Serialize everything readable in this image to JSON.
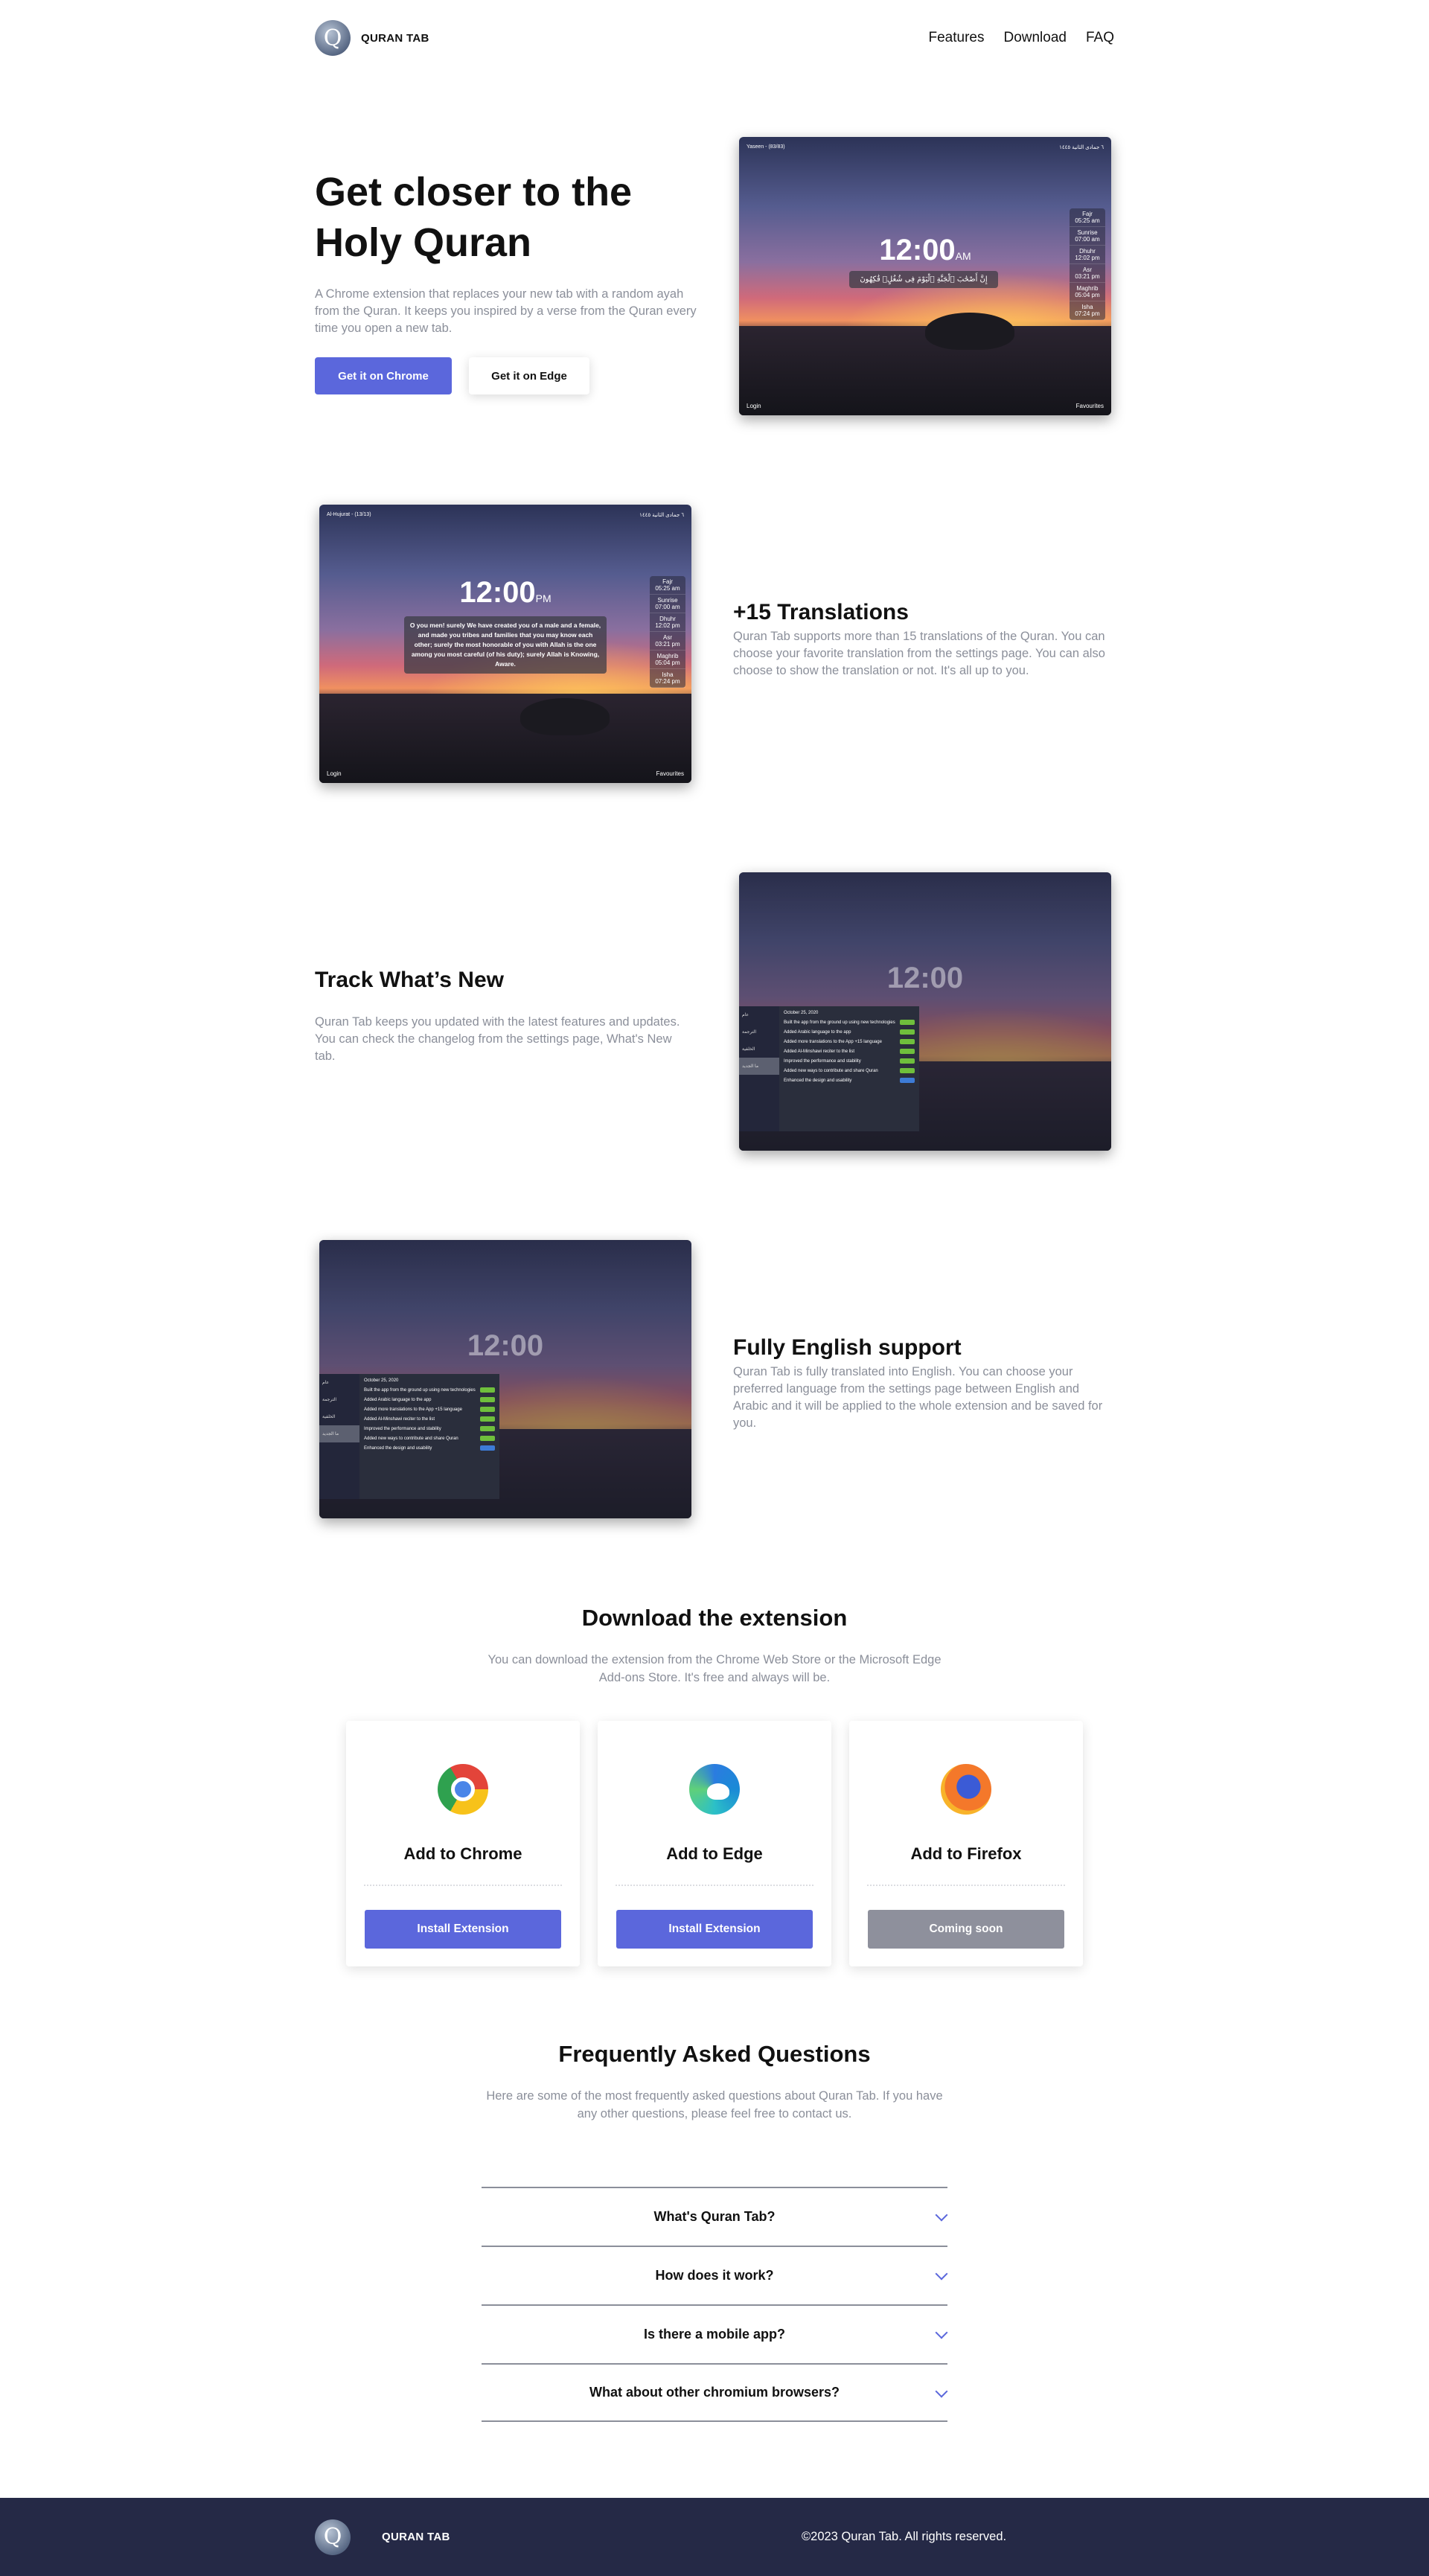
{
  "header": {
    "brand": "QURAN TAB",
    "logo_letter": "Q",
    "nav": [
      "Features",
      "Download",
      "FAQ"
    ]
  },
  "hero": {
    "title_line1": "Get closer to the",
    "title_line2": "Holy Quran",
    "description": "A Chrome extension that replaces your new tab with a random ayah from the Quran. It keeps you inspired by a verse from the Quran every time you open a new tab.",
    "btn_chrome": "Get it on Chrome",
    "btn_edge": "Get it on Edge"
  },
  "mock": {
    "time": "12:00",
    "ampm": "AM",
    "pm": "PM",
    "surah1": "Yaseen - (83/83)",
    "surah2": "Al-Hujurat - (13/13)",
    "hijri": "٦ جمادى الثانية ١٤٤٥",
    "ayah_ar": "إِنَّ أَصْحَٰبَ ٱلْجَنَّةِ ٱلْيَوْمَ فِى شُغُلٍۢ فَٰكِهُونَ",
    "ayah_en": "O you men! surely We have created you of a male and a female, and made you tribes and families that you may know each other; surely the most honorable of you with Allah is the one among you most careful (of his duty); surely Allah is Knowing, Aware.",
    "prayers": [
      "Fajr",
      "05:25 am",
      "Sunrise",
      "07:00 am",
      "Dhuhr",
      "12:02 pm",
      "Asr",
      "03:21 pm",
      "Maghrib",
      "05:04 pm",
      "Isha",
      "07:24 pm"
    ],
    "login": "Login",
    "favourites": "Favourites",
    "changelog_date": "October 25, 2020",
    "changelog": [
      "Built the app from the ground up using new technologies",
      "Added Arabic language to the app",
      "Added more translations to the App +15 language",
      "Added Al-Minshawi reciter to the list",
      "Improved the performance and stability",
      "Added new ways to contribute and share Quran",
      "Enhanced the design and usability"
    ],
    "panel_tabs": [
      "عام",
      "الترجمة",
      "الخلفية",
      "ما الجديد"
    ]
  },
  "features": [
    {
      "title": "+15 Translations",
      "desc": "Quran Tab supports more than 15 translations of the Quran. You can choose your favorite translation from the settings page. You can also choose to show the translation or not. It's all up to you."
    },
    {
      "title": "Track What’s New",
      "desc": "Quran Tab keeps you updated with the latest features and updates. You can check the changelog from the settings page, What's New tab."
    },
    {
      "title": "Fully English support",
      "desc": "Quran Tab is fully translated into English. You can choose your preferred language from the settings page between English and Arabic and it will be applied to the whole extension and be saved for you."
    }
  ],
  "download": {
    "title": "Download the extension",
    "subtitle": "You can download the extension from the Chrome Web Store or the Microsoft Edge Add-ons Store. It's free and always will be.",
    "cards": [
      {
        "title": "Add to Chrome",
        "button": "Install Extension",
        "color": "#5b67dc",
        "icon": "chrome-icon"
      },
      {
        "title": "Add to Edge",
        "button": "Install Extension",
        "color": "#5b67dc",
        "icon": "edge-icon"
      },
      {
        "title": "Add to Firefox",
        "button": "Coming soon",
        "color": "#8e909c",
        "icon": "firefox-icon"
      }
    ]
  },
  "faq": {
    "title": "Frequently Asked Questions",
    "subtitle": "Here are some of the most frequently asked questions about Quran Tab. If you have any other questions, please feel free to contact us.",
    "questions": [
      "What's Quran Tab?",
      "How does it work?",
      "Is there a mobile app?",
      "What about other chromium browsers?"
    ]
  },
  "footer": {
    "brand": "QURAN TAB",
    "copyright": "©2023 Quran Tab. All rights reserved."
  },
  "colors": {
    "accent": "#5b67dc",
    "footer_bg": "#252946",
    "muted_text": "#8b8f9a",
    "disabled": "#8e909c"
  }
}
